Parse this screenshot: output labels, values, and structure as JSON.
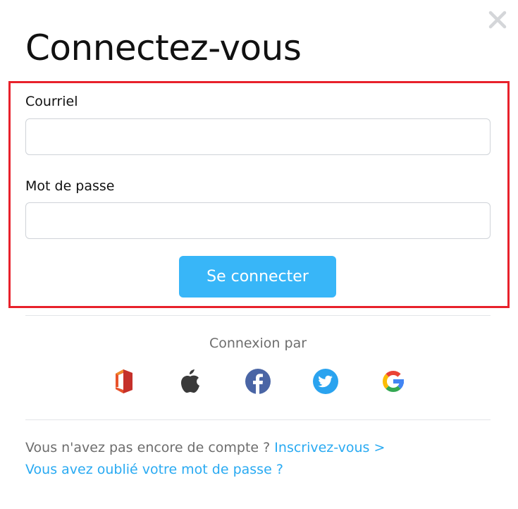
{
  "dialog": {
    "title": "Connectez-vous",
    "close_icon": "close-icon"
  },
  "form": {
    "email_label": "Courriel",
    "email_value": "",
    "password_label": "Mot de passe",
    "password_value": "",
    "submit_label": "Se connecter"
  },
  "social": {
    "title": "Connexion par",
    "providers": [
      {
        "name": "Office",
        "icon": "office-icon"
      },
      {
        "name": "Apple",
        "icon": "apple-icon"
      },
      {
        "name": "Facebook",
        "icon": "facebook-icon"
      },
      {
        "name": "Twitter",
        "icon": "twitter-icon"
      },
      {
        "name": "Google",
        "icon": "google-icon"
      }
    ]
  },
  "footer": {
    "signup_prompt": "Vous n'avez pas encore de compte ?",
    "signup_link": "Inscrivez-vous >",
    "forgot_link": "Vous avez oublié votre mot de passe ?"
  },
  "colors": {
    "accent": "#38b6f8",
    "link": "#29aaf2",
    "highlight": "#e8212b",
    "muted_text": "#6d6d6d"
  }
}
